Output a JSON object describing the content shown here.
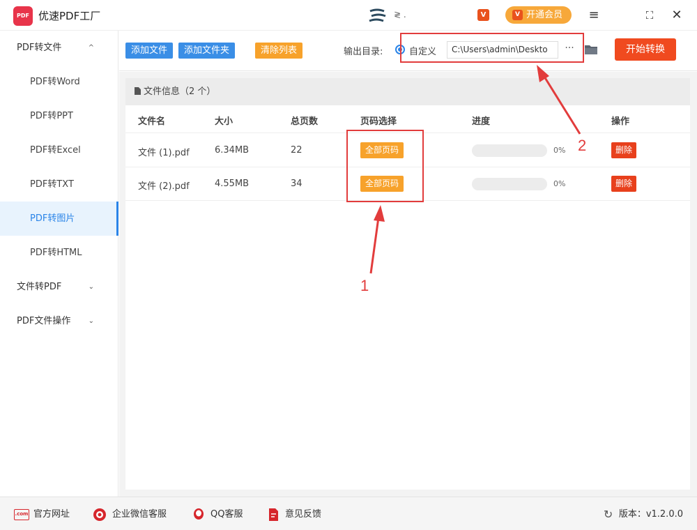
{
  "app": {
    "title": "优速PDF工厂",
    "logo_text": "PDF",
    "brand_text": "≷ .",
    "vip_small_label": "V",
    "vip_button_label": "开通会员",
    "vip_button_icon": "V"
  },
  "window_controls": {
    "menu": "≡",
    "maximize": "⛶",
    "close": "✕"
  },
  "sidebar": {
    "groups": [
      {
        "label": "PDF转文件",
        "caret": "^",
        "expanded": true
      },
      {
        "label": "文件转PDF",
        "caret": "⌄",
        "expanded": false
      },
      {
        "label": "PDF文件操作",
        "caret": "⌄",
        "expanded": false
      }
    ],
    "items": [
      {
        "label": "PDF转Word"
      },
      {
        "label": "PDF转PPT"
      },
      {
        "label": "PDF转Excel"
      },
      {
        "label": "PDF转TXT"
      },
      {
        "label": "PDF转图片"
      },
      {
        "label": "PDF转HTML"
      }
    ],
    "active_item": "PDF转图片"
  },
  "toolbar": {
    "add_file": "添加文件",
    "add_folder": "添加文件夹",
    "clear_list": "清除列表",
    "output_label": "输出目录:",
    "radio_label": "自定义",
    "output_path": "C:\\Users\\admin\\Deskto",
    "more": "···",
    "start": "开始转换"
  },
  "file_panel": {
    "header": "文件信息（2 个）",
    "columns": [
      "文件名",
      "大小",
      "总页数",
      "页码选择",
      "进度",
      "操作"
    ],
    "rows": [
      {
        "name": "文件 (1).pdf",
        "size": "6.34MB",
        "pages": "22",
        "page_select": "全部页码",
        "progress": 0,
        "progress_text": "0%",
        "action": "删除"
      },
      {
        "name": "文件 (2).pdf",
        "size": "4.55MB",
        "pages": "34",
        "page_select": "全部页码",
        "progress": 0,
        "progress_text": "0%",
        "action": "删除"
      }
    ]
  },
  "annotations": {
    "label_1": "1",
    "label_2": "2",
    "color": "#e23c3c"
  },
  "footer": {
    "website": "官方网址",
    "website_icon": ".com",
    "wechat": "企业微信客服",
    "qq": "QQ客服",
    "feedback": "意见反馈",
    "version": "版本：v1.2.0.0"
  },
  "colors": {
    "primary_blue": "#3a8ee6",
    "orange": "#f7a22b",
    "start_red": "#f04a1f",
    "delete_red": "#e8401c"
  }
}
